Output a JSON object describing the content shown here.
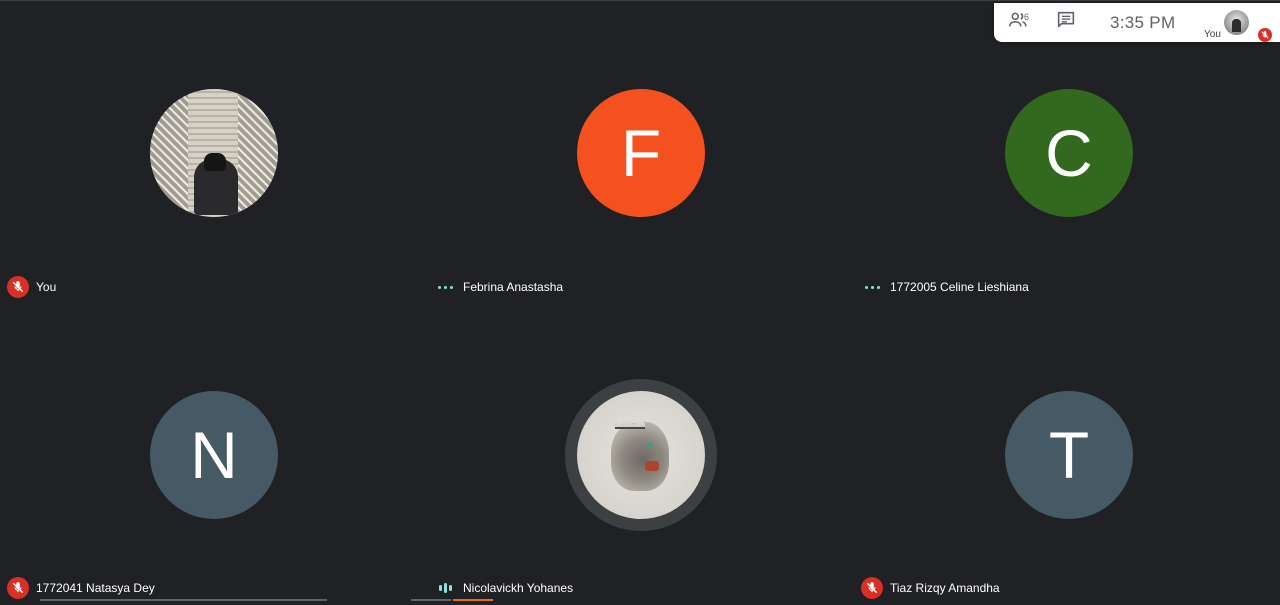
{
  "topbar": {
    "people_icon": "people-icon",
    "people_count": "6",
    "chat_icon": "chat-icon",
    "time": "3:35 PM",
    "self_label": "You"
  },
  "participants": [
    {
      "name": "You",
      "status": "muted",
      "avatar_type": "photo",
      "avatar_color": "#bdb8ae"
    },
    {
      "name": "Febrina Anastasha",
      "status": "idle",
      "avatar_letter": "F",
      "avatar_color": "#f4511e"
    },
    {
      "name": "1772005 Celine Lieshiana",
      "status": "idle",
      "avatar_letter": "C",
      "avatar_color": "#33691e"
    },
    {
      "name": "1772041 Natasya Dey",
      "status": "muted",
      "avatar_letter": "N",
      "avatar_color": "#455a64"
    },
    {
      "name": "Nicolavickh Yohanes",
      "status": "speaking",
      "avatar_type": "photo",
      "avatar_color": "#d8d6cf"
    },
    {
      "name": "Tiaz Rizqy Amandha",
      "status": "muted",
      "avatar_letter": "T",
      "avatar_color": "#455a64"
    }
  ],
  "colors": {
    "background": "#202124",
    "mute_red": "#d93025",
    "indicator_teal": "#8ae3d9"
  }
}
